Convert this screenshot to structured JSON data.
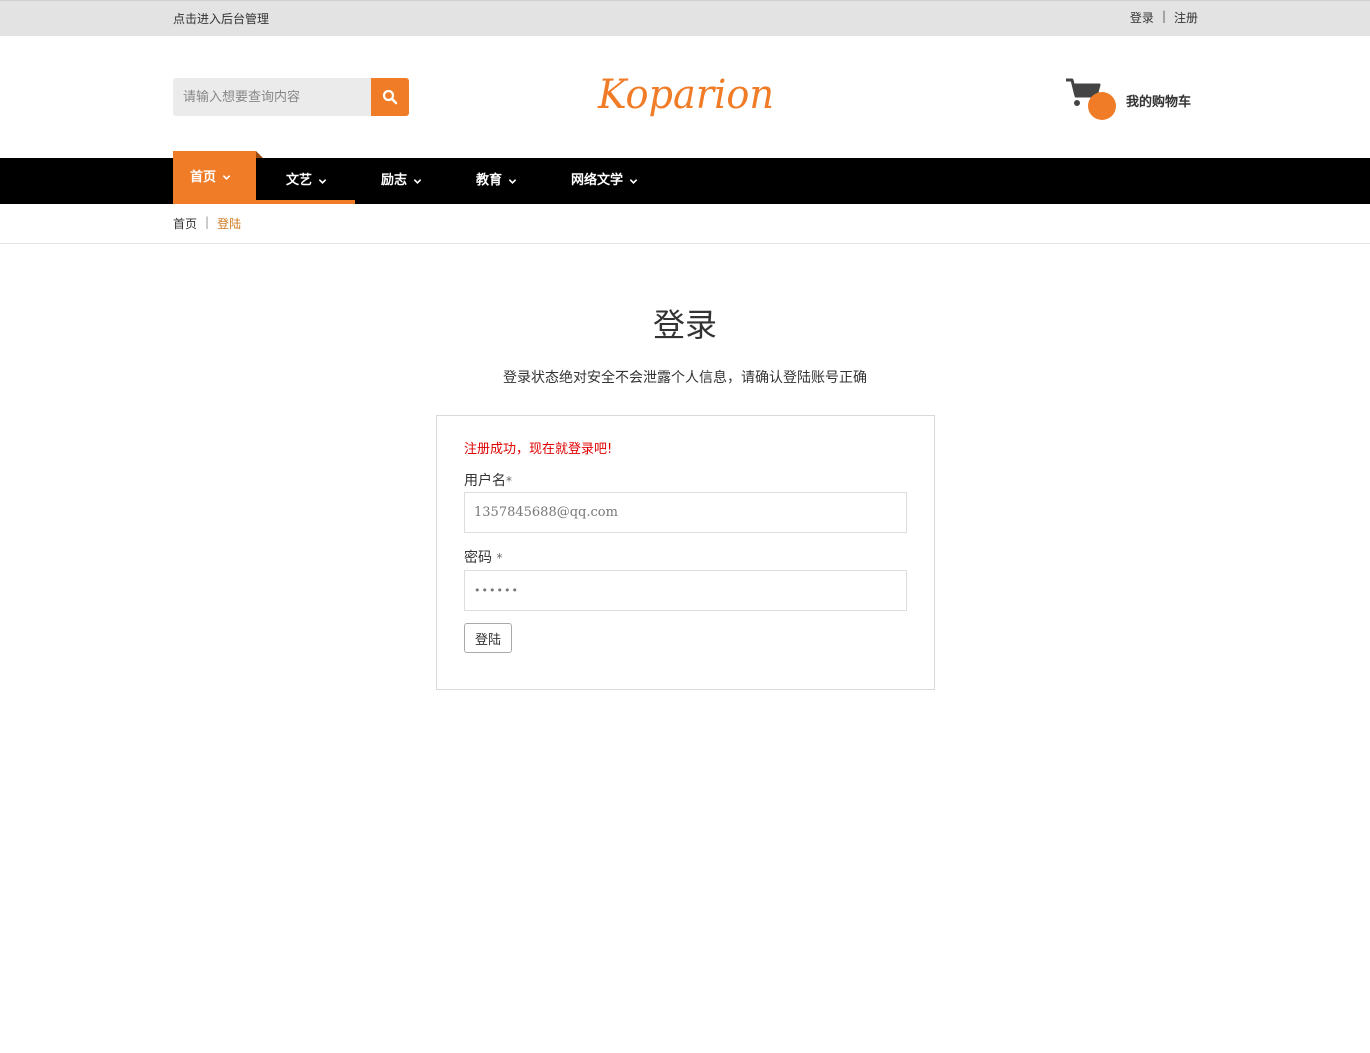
{
  "topbar": {
    "admin_link": "点击进入后台管理",
    "login_link": "登录",
    "separator": "|",
    "register_link": "注册"
  },
  "header": {
    "search": {
      "placeholder": "请输入想要查询内容",
      "icon": "search-icon"
    },
    "logo": {
      "text": "Koparion",
      "color": "#f07c28"
    },
    "cart": {
      "label": "我的购物车",
      "icon": "cart-icon"
    }
  },
  "nav": {
    "items": [
      {
        "label": "首页",
        "active": true
      },
      {
        "label": "文艺",
        "active": false
      },
      {
        "label": "励志",
        "active": false
      },
      {
        "label": "教育",
        "active": false
      },
      {
        "label": "网络文学",
        "active": false
      }
    ]
  },
  "breadcrumb": {
    "home": "首页",
    "separator": "|",
    "current": "登陆"
  },
  "main": {
    "title": "登录",
    "subtitle": "登录状态绝对安全不会泄露个人信息，请确认登陆账号正确"
  },
  "form": {
    "message": "注册成功，现在就登录吧!",
    "username_label": "用户名",
    "username_required": "*",
    "username_value": "1357845688@qq.com",
    "password_label": "密码",
    "password_required": "*",
    "password_value": "••••••",
    "submit_label": "登陆"
  },
  "colors": {
    "accent": "#f07c28",
    "error": "#e00000",
    "nav_bg": "#000000",
    "topbar_bg": "#e3e3e3"
  }
}
